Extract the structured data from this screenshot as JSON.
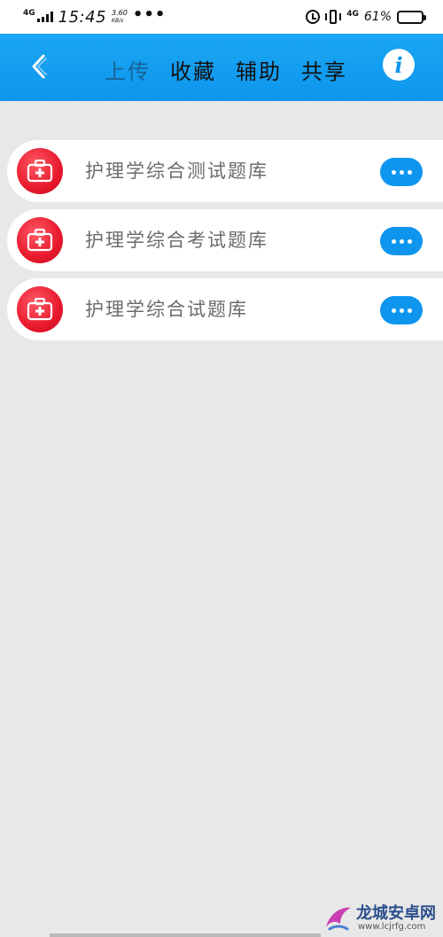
{
  "status_bar": {
    "network": "4G",
    "time": "15:45",
    "speed_value": "3.60",
    "speed_unit": "KB/s",
    "more": "•••",
    "network2": "4G",
    "battery_text": "61%",
    "battery_level": 0.61
  },
  "header": {
    "tabs": [
      {
        "label": "上传",
        "active": true
      },
      {
        "label": "收藏",
        "active": false
      },
      {
        "label": "辅助",
        "active": false
      },
      {
        "label": "共享",
        "active": false
      }
    ],
    "info_label": "i"
  },
  "list": {
    "items": [
      {
        "title": "护理学综合测试题库",
        "icon": "first-aid-kit-icon"
      },
      {
        "title": "护理学综合考试题库",
        "icon": "first-aid-kit-icon"
      },
      {
        "title": "护理学综合试题库",
        "icon": "first-aid-kit-icon"
      }
    ]
  },
  "watermark": {
    "name": "龙城安卓网",
    "url": "www.lcjrfg.com"
  },
  "colors": {
    "header": "#0e95ee",
    "background": "#e8e8e8",
    "icon_red": "#e8192c",
    "button_blue": "#0e95ee"
  }
}
